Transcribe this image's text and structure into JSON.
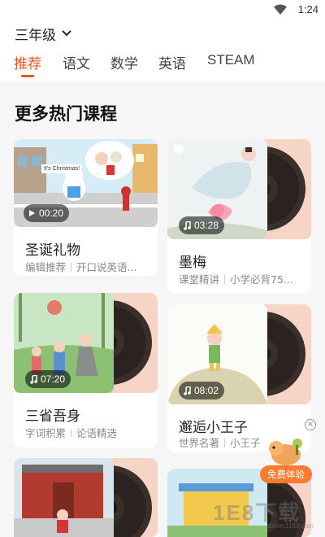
{
  "status_bar": {
    "time": "1:24"
  },
  "header": {
    "grade": "三年级",
    "tabs": [
      "推荐",
      "语文",
      "数学",
      "英语",
      "STEAM"
    ]
  },
  "section": {
    "title": "更多热门课程"
  },
  "courses": [
    {
      "title": "圣诞礼物",
      "duration": "00:20",
      "tags": [
        "编辑推荐",
        "开口说英语..."
      ],
      "thumb_text": "It's Christmas!"
    },
    {
      "title": "墨梅",
      "duration": "03:28",
      "tags": [
        "课堂精讲",
        "小学必背75..."
      ]
    },
    {
      "title": "三省吾身",
      "duration": "07:20",
      "tags": [
        "字词积累",
        "论语精选"
      ]
    },
    {
      "title": "邂逅小王子",
      "duration": "08:02",
      "tags": [
        "世界名著",
        "小王子"
      ]
    }
  ],
  "promo": {
    "button": "免费体验",
    "close": "×"
  },
  "watermark": {
    "main": "1E8下载",
    "sub": "down.1168.com"
  },
  "colors": {
    "accent": "#e0561b",
    "promo": "#ff7a2d"
  }
}
